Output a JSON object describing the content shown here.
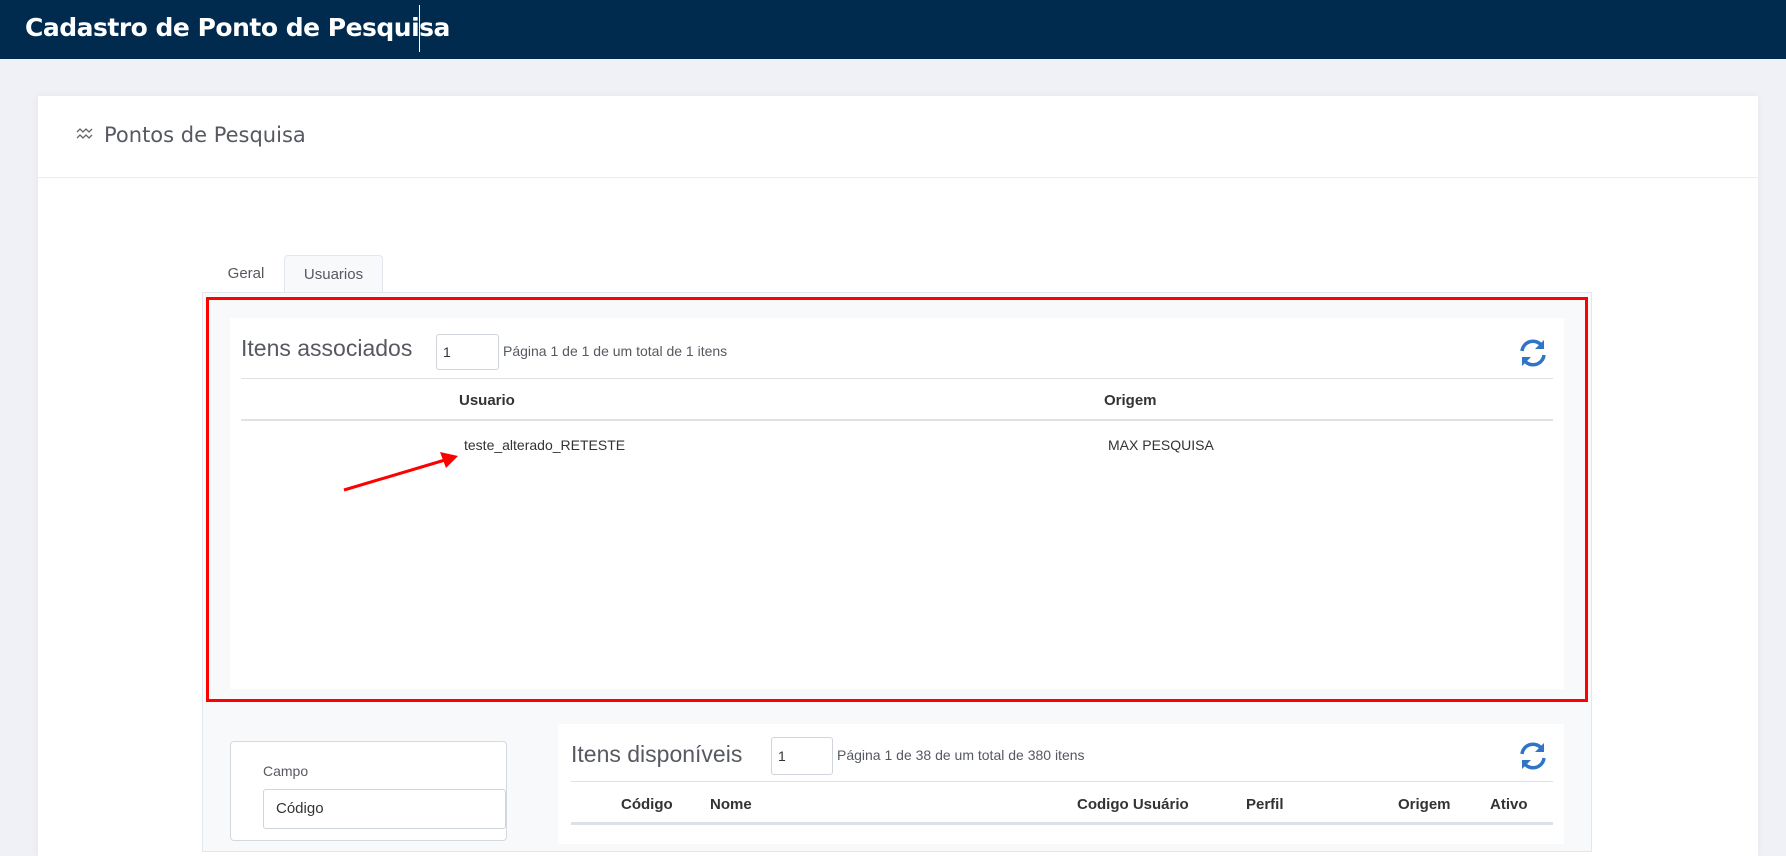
{
  "header": {
    "title": "Cadastro de Ponto de Pesquisa"
  },
  "card": {
    "title": "Pontos de Pesquisa",
    "icon": "chart-wave-icon"
  },
  "tabs": [
    {
      "label": "Geral",
      "active": false
    },
    {
      "label": "Usuarios",
      "active": true
    }
  ],
  "associated": {
    "title": "Itens associados",
    "page_input": "1",
    "pagination": "Página 1 de 1 de um total de 1 itens",
    "columns": [
      "Usuario",
      "Origem"
    ],
    "rows": [
      {
        "usuario": "teste_alterado_RETESTE",
        "origem": "MAX PESQUISA"
      }
    ]
  },
  "filter": {
    "label": "Campo",
    "value": "Código"
  },
  "available": {
    "title": "Itens disponíveis",
    "page_input": "1",
    "pagination": "Página 1 de 38 de um total de 380 itens",
    "columns": [
      "Código",
      "Nome",
      "Codigo Usuário",
      "Perfil",
      "Origem",
      "Ativo"
    ]
  },
  "colors": {
    "header": "#002a4e",
    "highlight": "#ff0000",
    "refresh": "#2f74c6"
  }
}
